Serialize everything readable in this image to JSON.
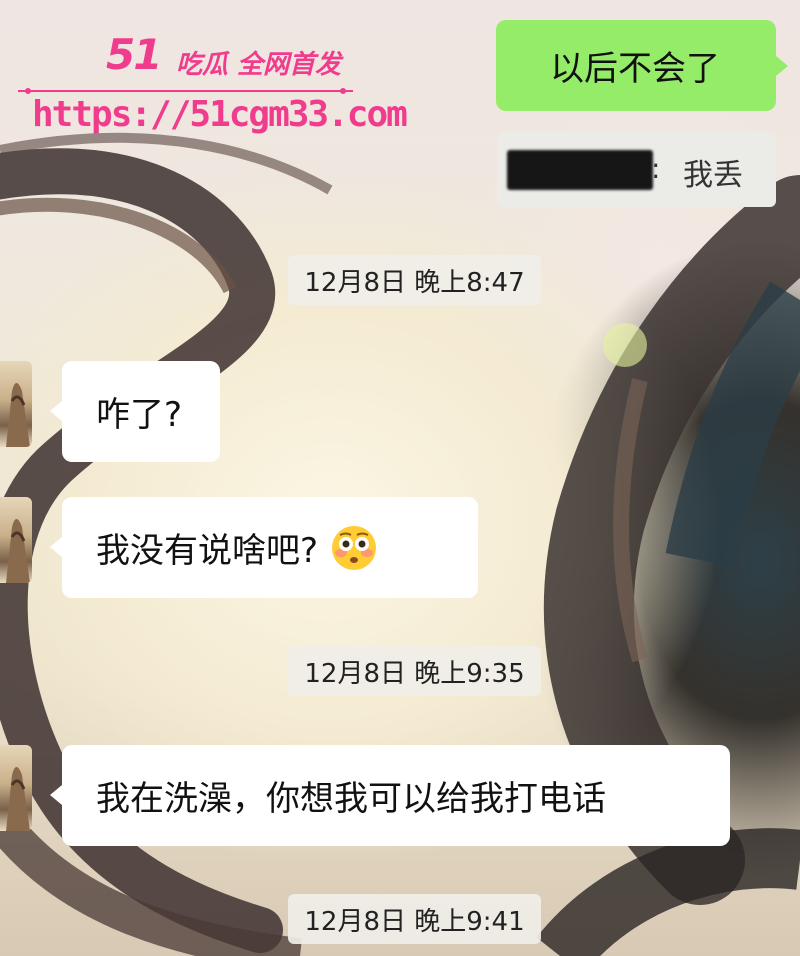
{
  "watermark": {
    "number": "51",
    "tagline": "吃瓜 全网首发",
    "url": "https://51cgm33.com"
  },
  "messages": [
    {
      "id": "m1",
      "side": "right",
      "text": "以后不会了"
    },
    {
      "id": "q1",
      "type": "quote",
      "text": "我丢"
    },
    {
      "id": "t1",
      "type": "timestamp",
      "text": "12月8日 晚上8:47"
    },
    {
      "id": "m2",
      "side": "left",
      "text": "咋了?"
    },
    {
      "id": "m3",
      "side": "left",
      "text": "我没有说啥吧?",
      "emoji": "flushed-face"
    },
    {
      "id": "t2",
      "type": "timestamp",
      "text": "12月8日 晚上9:35"
    },
    {
      "id": "m4",
      "side": "left",
      "text": "我在洗澡，你想我可以给我打电话"
    },
    {
      "id": "t3",
      "type": "timestamp",
      "text": "12月8日 晚上9:41"
    }
  ],
  "colors": {
    "outgoing_bubble": "#95ec69",
    "incoming_bubble": "#ffffff",
    "watermark": "#f03c8c"
  }
}
